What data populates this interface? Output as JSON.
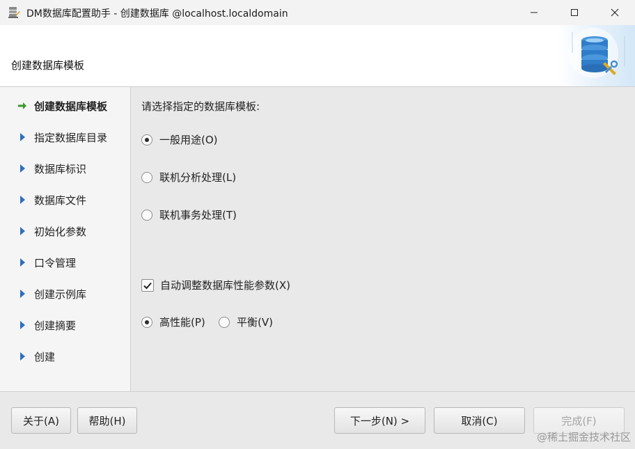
{
  "window": {
    "title": "DM数据库配置助手 - 创建数据库 @localhost.localdomain"
  },
  "header": {
    "title": "创建数据库模板"
  },
  "nav": {
    "items": [
      {
        "label": "创建数据库模板",
        "active": true
      },
      {
        "label": "指定数据库目录",
        "active": false
      },
      {
        "label": "数据库标识",
        "active": false
      },
      {
        "label": "数据库文件",
        "active": false
      },
      {
        "label": "初始化参数",
        "active": false
      },
      {
        "label": "口令管理",
        "active": false
      },
      {
        "label": "创建示例库",
        "active": false
      },
      {
        "label": "创建摘要",
        "active": false
      },
      {
        "label": "创建",
        "active": false
      }
    ],
    "active_arrow_color": "#3a9a2f",
    "arrow_color": "#2f6fbf"
  },
  "main": {
    "prompt": "请选择指定的数据库模板:",
    "templates": [
      {
        "label": "一般用途(O)",
        "checked": true
      },
      {
        "label": "联机分析处理(L)",
        "checked": false
      },
      {
        "label": "联机事务处理(T)",
        "checked": false
      }
    ],
    "auto_tune": {
      "label": "自动调整数据库性能参数(X)",
      "checked": true
    },
    "performance": [
      {
        "label": "高性能(P)",
        "checked": true
      },
      {
        "label": "平衡(V)",
        "checked": false
      }
    ]
  },
  "footer": {
    "about": "关于(A)",
    "help": "帮助(H)",
    "next": "下一步(N) >",
    "cancel": "取消(C)",
    "finish": "完成(F)"
  },
  "watermark": "@稀土掘金技术社区"
}
